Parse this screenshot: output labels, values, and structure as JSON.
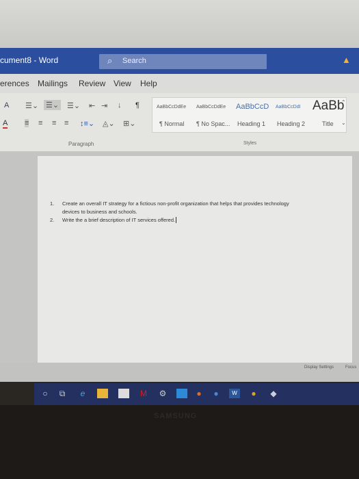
{
  "titlebar": {
    "title": "cument8  -  Word",
    "search_placeholder": "Search",
    "warning_icon": "warning-icon"
  },
  "tabs": [
    "erences",
    "Mailings",
    "Review",
    "View",
    "Help"
  ],
  "ribbon": {
    "paragraph_label": "Paragraph",
    "styles_label": "Styles",
    "styles": [
      {
        "preview": "AaBbCcDdEe",
        "label": "¶ Normal"
      },
      {
        "preview": "AaBbCcDdEe",
        "label": "¶ No Spac..."
      },
      {
        "preview": "AaBbCcD",
        "label": "Heading 1"
      },
      {
        "preview": "AaBbCcDdI",
        "label": "Heading 2"
      },
      {
        "preview": "AaBb",
        "label": "Title"
      }
    ]
  },
  "document": {
    "items": [
      {
        "num": "1.",
        "text": "Create an overall IT strategy for a fictious non-profit organization that helps that provides technology devices to business and schools."
      },
      {
        "num": "2.",
        "text": "Write the a brief description of IT services offered."
      }
    ]
  },
  "status": {
    "display_settings": "Display Settings",
    "focus": "Focus"
  },
  "bezel": {
    "brand": "SAMSUNG"
  }
}
